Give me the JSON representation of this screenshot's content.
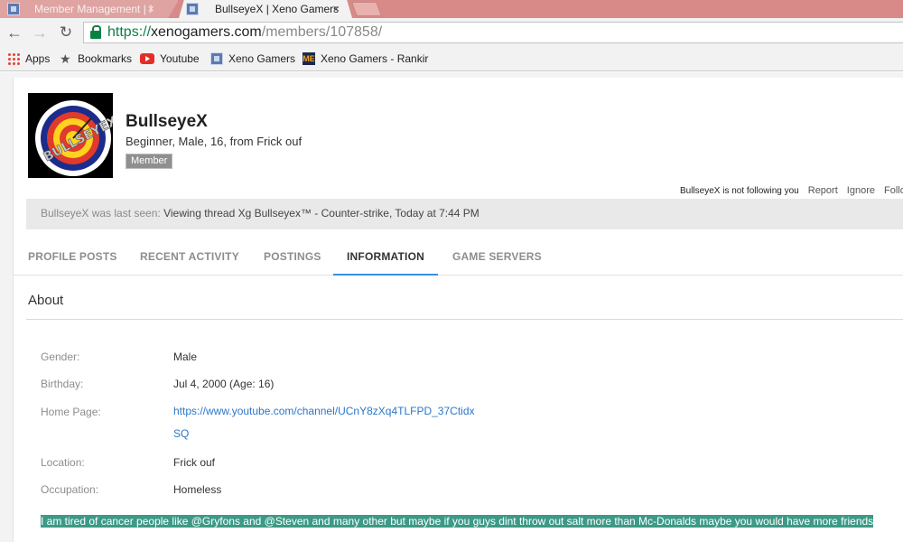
{
  "browser": {
    "tabs": [
      {
        "title": "Member Management | X",
        "active": false,
        "close": "×"
      },
      {
        "title": "BullseyeX | Xeno Gamers",
        "active": true,
        "close": "×"
      }
    ],
    "url": {
      "scheme": "https://",
      "host": "xenogamers.com",
      "path": "/members/107858/"
    },
    "bookmarks": [
      {
        "label": "Apps",
        "icon": "apps-grid-icon"
      },
      {
        "label": "Bookmarks",
        "icon": "star-icon"
      },
      {
        "label": "Youtube",
        "icon": "youtube-icon"
      },
      {
        "label": "Xeno Gamers",
        "icon": "xeno-gamers-icon"
      },
      {
        "label": "Xeno Gamers - Rankir",
        "icon": "me-icon"
      }
    ]
  },
  "profile": {
    "avatar_text": "BULLSEYEX",
    "username": "BullseyeX",
    "user_title": "Beginner, Male, 16, from Frick ouf",
    "badge": "Member",
    "follow_status": "BullseyeX is not following you",
    "actions": [
      "Report",
      "Ignore",
      "Follo"
    ],
    "last_seen_label": "BullseyeX was last seen:",
    "last_seen_activity": "Viewing thread Xg Bullseyex™ - Counter-strike, Today at 7:44 PM",
    "tabs": [
      {
        "label": "PROFILE POSTS",
        "active": false
      },
      {
        "label": "RECENT ACTIVITY",
        "active": false
      },
      {
        "label": "POSTINGS",
        "active": false
      },
      {
        "label": "INFORMATION",
        "active": true
      },
      {
        "label": "GAME SERVERS",
        "active": false
      }
    ],
    "about_title": "About",
    "info": {
      "gender_label": "Gender:",
      "gender": "Male",
      "birthday_label": "Birthday:",
      "birthday": "Jul 4, 2000 (Age: 16)",
      "homepage_label": "Home Page:",
      "homepage": "https://www.youtube.com/channel/UCnY8zXq4TLFPD_37CtidxSQ",
      "location_label": "Location:",
      "location": "Frick ouf",
      "occupation_label": "Occupation:",
      "occupation": "Homeless"
    },
    "bio": "I am tired of cancer people like @Gryfons and @Steven and many other but maybe if you guys dint throw out salt more than Mc-Donalds maybe you would have more friends"
  },
  "colors": {
    "tabstrip": "#d78a87",
    "secure_green": "#0b8043",
    "link_blue": "#2d77c7",
    "active_tab_underline": "#3c8ee0",
    "bio_highlight": "#3c9a86"
  }
}
